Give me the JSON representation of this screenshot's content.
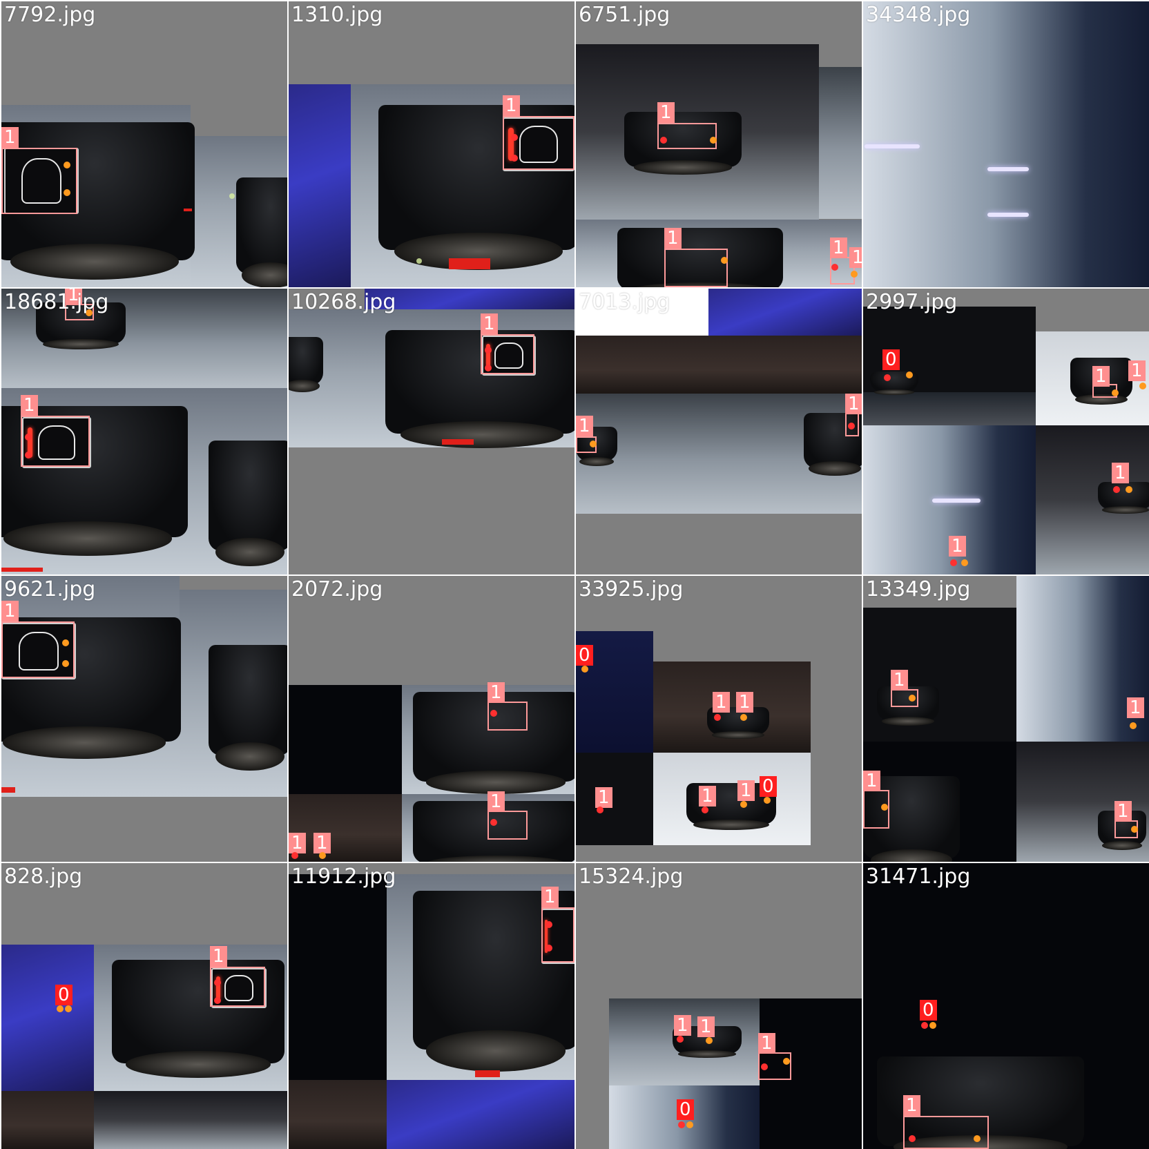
{
  "tiles": [
    {
      "filename": "7792.jpg",
      "labels": [
        "1"
      ]
    },
    {
      "filename": "1310.jpg",
      "labels": [
        "1"
      ]
    },
    {
      "filename": "6751.jpg",
      "labels": [
        "1",
        "1",
        "1",
        "1"
      ]
    },
    {
      "filename": "34348.jpg",
      "labels": []
    },
    {
      "filename": "18681.jpg",
      "labels": [
        "1",
        "1"
      ]
    },
    {
      "filename": "10268.jpg",
      "labels": [
        "1"
      ]
    },
    {
      "filename": "7013.jpg",
      "labels": [
        "1",
        "1"
      ]
    },
    {
      "filename": "2997.jpg",
      "labels": [
        "0",
        "1",
        "1",
        "1",
        "1"
      ]
    },
    {
      "filename": "9621.jpg",
      "labels": [
        "1"
      ]
    },
    {
      "filename": "2072.jpg",
      "labels": [
        "1",
        "1",
        "1",
        "1"
      ]
    },
    {
      "filename": "33925.jpg",
      "labels": [
        "0",
        "1",
        "1",
        "1",
        "1",
        "1",
        "0"
      ]
    },
    {
      "filename": "13349.jpg",
      "labels": [
        "1",
        "1",
        "1",
        "1"
      ]
    },
    {
      "filename": "828.jpg",
      "labels": [
        "1",
        "0"
      ]
    },
    {
      "filename": "11912.jpg",
      "labels": [
        "1"
      ]
    },
    {
      "filename": "15324.jpg",
      "labels": [
        "1",
        "1",
        "1",
        "0"
      ]
    },
    {
      "filename": "31471.jpg",
      "labels": [
        "0",
        "1"
      ]
    }
  ],
  "colors": {
    "box_class_1": "#ff9a9a",
    "box_class_0": "#ff1f1f",
    "keypoint_red": "#ff3030",
    "keypoint_orange": "#ff9a1f",
    "padding_gray": "#7f7f7f"
  }
}
